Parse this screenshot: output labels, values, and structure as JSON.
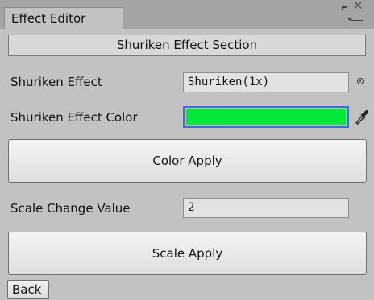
{
  "window": {
    "tab_title": "Effect Editor"
  },
  "icons": {
    "maximize": "maximize-icon",
    "close": "close-icon",
    "menu": "menu-icon",
    "object_picker": "object-picker-icon",
    "eyedropper": "eyedropper-icon"
  },
  "section": {
    "title": "Shuriken Effect Section"
  },
  "shuriken_effect": {
    "label": "Shuriken Effect",
    "value": "Shuriken(1x)"
  },
  "shuriken_color": {
    "label": "Shuriken Effect Color",
    "color": "#00e83a"
  },
  "buttons": {
    "color_apply": "Color Apply",
    "scale_apply": "Scale Apply",
    "back": "Back"
  },
  "scale": {
    "label": "Scale Change Value",
    "value": "2"
  },
  "colors": {
    "background": "#c2c2c2",
    "tab_bar": "#a4a4a4",
    "focus_border": "#3b6fd4"
  }
}
